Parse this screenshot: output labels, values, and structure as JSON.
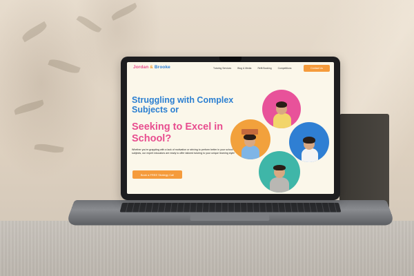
{
  "site": {
    "logo": {
      "part1": "Jordan",
      "part2": " & ",
      "part3": "Brooke"
    },
    "nav": [
      {
        "label": "Tutoring Services"
      },
      {
        "label": "Blog & Media"
      },
      {
        "label": "Refit Booking"
      },
      {
        "label": "Competitions"
      }
    ],
    "contact_label": "Contact Us",
    "headline_primary": "Struggling with Complex Subjects or",
    "headline_secondary": "Seeking to Excel in School?",
    "body": "Whether you're grappling with a lack of motivation or striving to perform better in your school subjects, our expert educators are ready to offer tailored tutoring to your unique learning style!",
    "cta_label": "Book a FREE Strategy Call"
  },
  "colors": {
    "blue": "#2b7fd1",
    "pink": "#e84d8f",
    "orange": "#f59b3c",
    "circle_pink": "#e8529a",
    "circle_orange": "#f2a13c",
    "circle_blue": "#2f7fd3",
    "circle_teal": "#3fb6a8"
  }
}
